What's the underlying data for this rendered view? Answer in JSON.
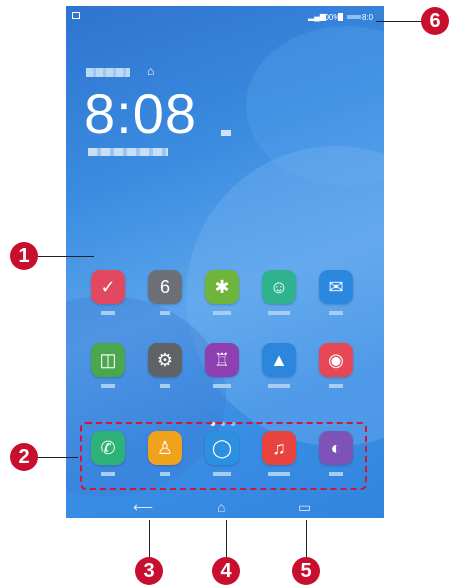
{
  "status_bar": {
    "battery": "100%",
    "time": "8:0"
  },
  "widget": {
    "time": "8:08"
  },
  "apps_row1": [
    {
      "icon": "clock-icon",
      "color": "#e2485f",
      "glyph": "✓"
    },
    {
      "icon": "calendar-icon",
      "color": "#6c6f75",
      "glyph": "6"
    },
    {
      "icon": "tools-icon",
      "color": "#6fb53b",
      "glyph": "✱"
    },
    {
      "icon": "support-icon",
      "color": "#2fb38e",
      "glyph": "☺"
    },
    {
      "icon": "email-icon",
      "color": "#2a88de",
      "glyph": "✉"
    }
  ],
  "apps_row2": [
    {
      "icon": "app-store-icon",
      "color": "#4aa74d",
      "glyph": "◫"
    },
    {
      "icon": "settings-icon",
      "color": "#5f6368",
      "glyph": "⚙"
    },
    {
      "icon": "themes-icon",
      "color": "#8e3fb0",
      "glyph": "♖"
    },
    {
      "icon": "gallery-icon",
      "color": "#2b86dc",
      "glyph": "▲"
    },
    {
      "icon": "camera-icon",
      "color": "#e74856",
      "glyph": "◉"
    }
  ],
  "dock": [
    {
      "icon": "phone-icon",
      "color": "#2fb27a",
      "glyph": "✆"
    },
    {
      "icon": "contacts-icon",
      "color": "#f0a21c",
      "glyph": "♙"
    },
    {
      "icon": "messaging-icon",
      "color": "#2d8fe0",
      "glyph": "◯"
    },
    {
      "icon": "music-icon",
      "color": "#e8433f",
      "glyph": "♫"
    },
    {
      "icon": "browser-icon",
      "color": "#7d53b8",
      "glyph": "◐"
    }
  ],
  "nav": {
    "back": "⟵",
    "home": "⌂",
    "recent": "▭"
  },
  "callouts": [
    "1",
    "2",
    "3",
    "4",
    "5",
    "6"
  ]
}
